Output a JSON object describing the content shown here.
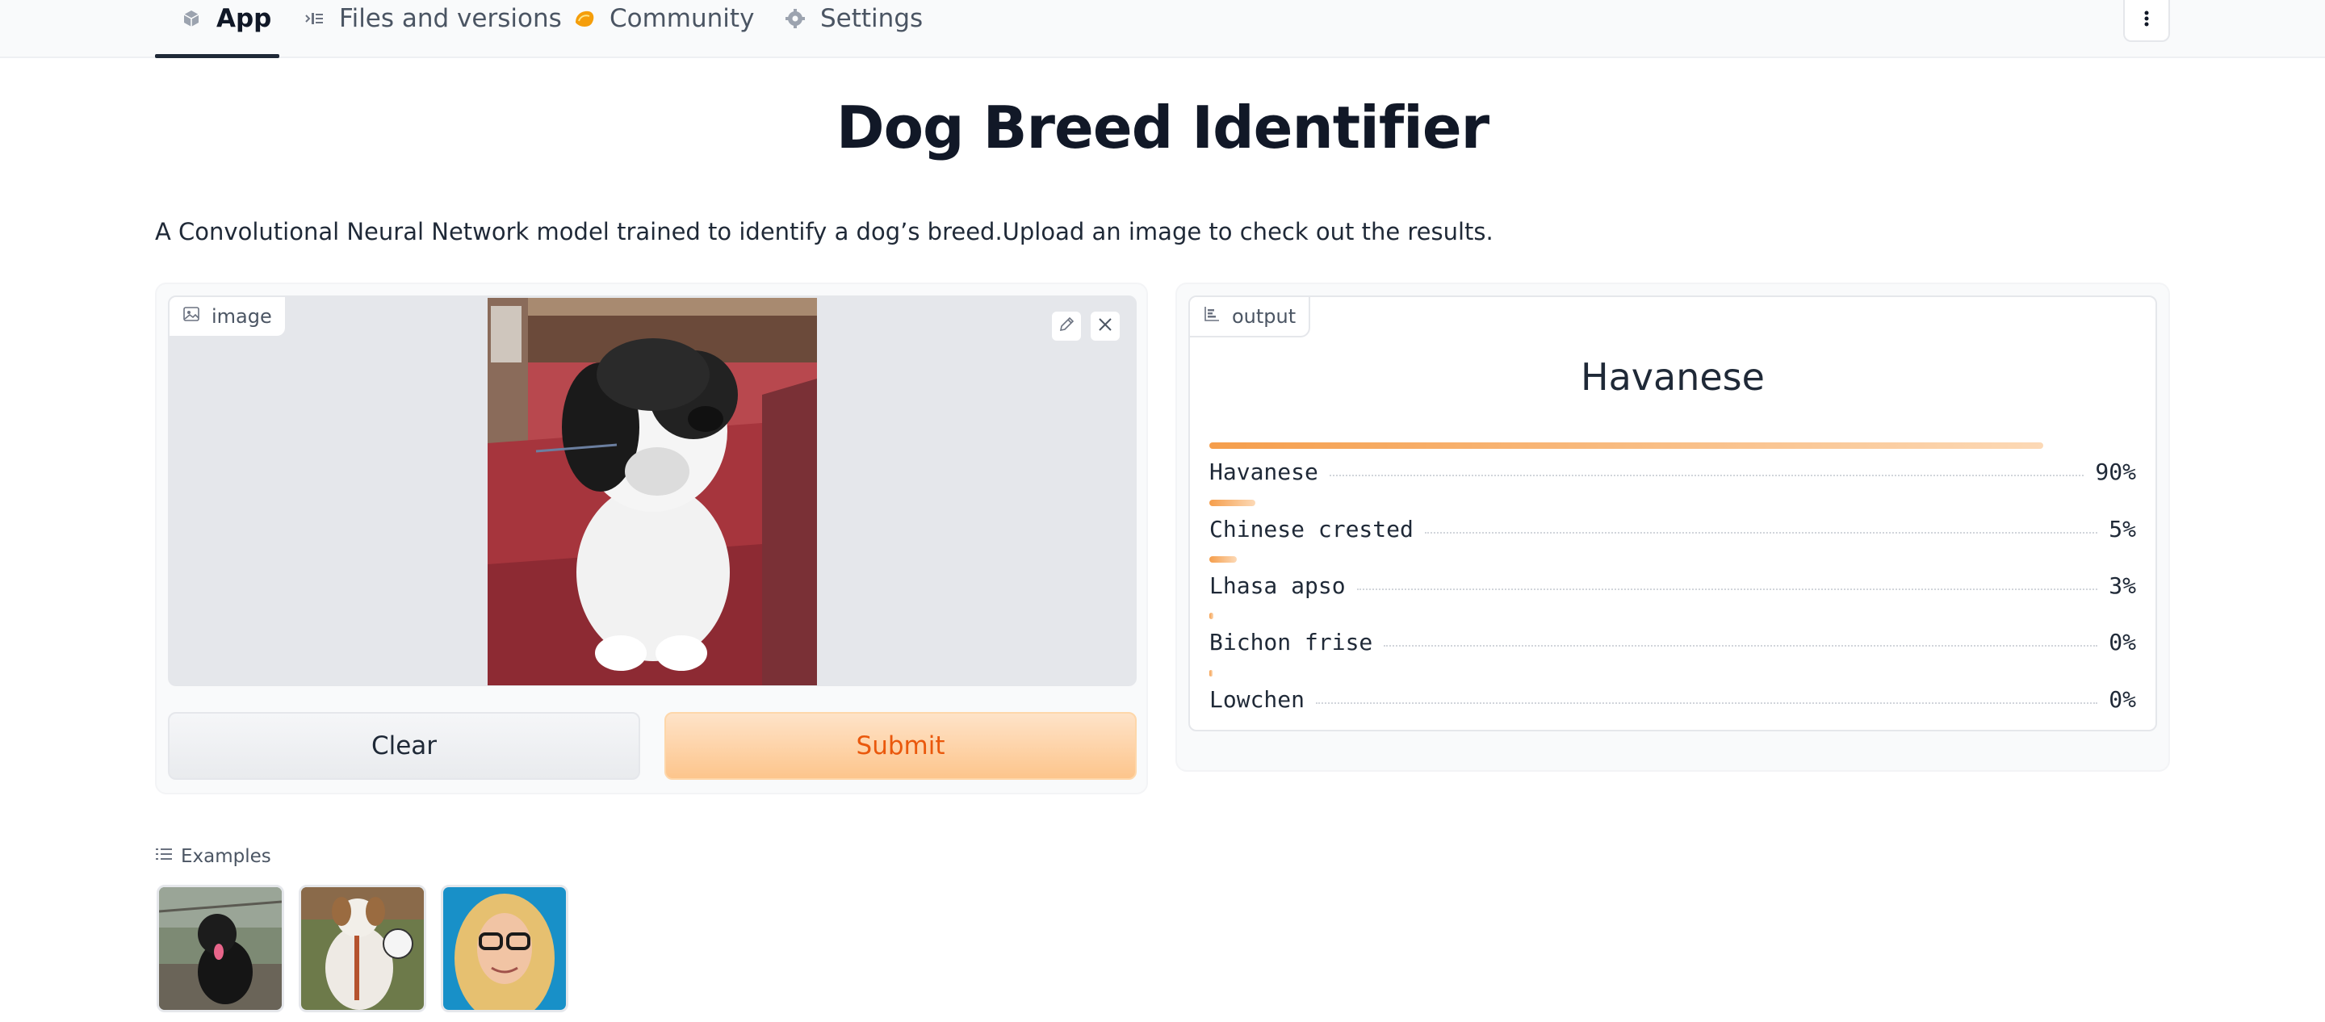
{
  "tabs": [
    {
      "label": "App",
      "icon": "cube-icon",
      "active": true
    },
    {
      "label": "Files and versions",
      "icon": "files-icon",
      "active": false
    },
    {
      "label": "Community",
      "icon": "community-icon",
      "active": false
    },
    {
      "label": "Settings",
      "icon": "gear-icon",
      "active": false
    }
  ],
  "title": "Dog Breed Identifier",
  "description": "A Convolutional Neural Network model trained to identify a dog’s breed.Upload an image to check out the results.",
  "input": {
    "label": "image",
    "buttons": {
      "clear": "Clear",
      "submit": "Submit"
    }
  },
  "output": {
    "label": "output",
    "top_label": "Havanese",
    "confidences": [
      {
        "label": "Havanese",
        "value": "90%",
        "fraction": 0.9
      },
      {
        "label": "Chinese crested",
        "value": "5%",
        "fraction": 0.05
      },
      {
        "label": "Lhasa apso",
        "value": "3%",
        "fraction": 0.03
      },
      {
        "label": "Bichon frise",
        "value": "0%",
        "fraction": 0.004
      },
      {
        "label": "Lowchen",
        "value": "0%",
        "fraction": 0.003
      }
    ]
  },
  "examples": {
    "label": "Examples",
    "items": [
      "black-labrador-example",
      "white-brown-dog-example",
      "person-with-glasses-example"
    ]
  },
  "colors": {
    "accent": "#f59e4c",
    "submit_text": "#ea580c",
    "submit_bg": "#fdc58c"
  }
}
